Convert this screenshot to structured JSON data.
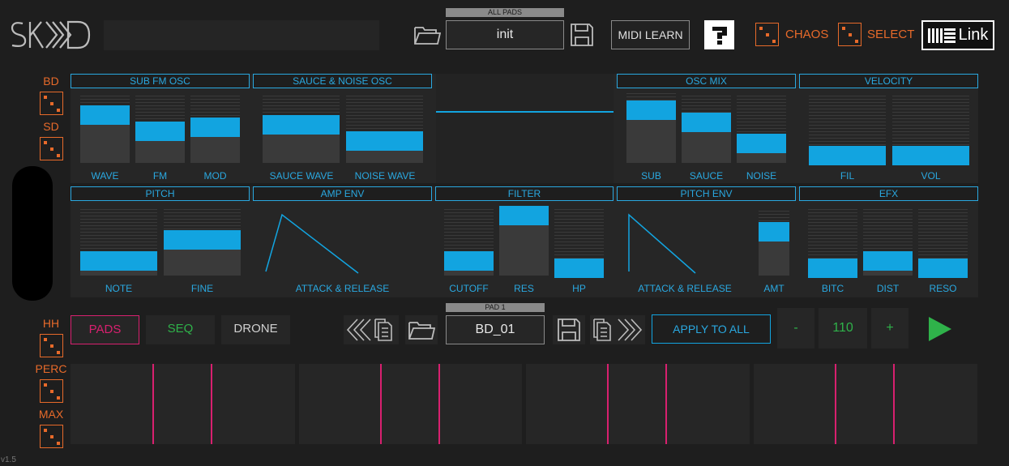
{
  "header": {
    "preset_caption": "ALL PADS",
    "preset_name": "init",
    "midi_learn_label": "MIDI LEARN",
    "chaos_label": "CHAOS",
    "select_label": "SELECT",
    "link_label": "Link"
  },
  "sidebar": {
    "pads": [
      {
        "label": "BD"
      },
      {
        "label": "SD"
      },
      {
        "label": "HH"
      },
      {
        "label": "PERC"
      },
      {
        "label": "MAX"
      }
    ]
  },
  "panels": {
    "sub_fm_osc": {
      "title": "SUB FM OSC",
      "sliders": [
        {
          "label": "WAVE",
          "value": 0.8
        },
        {
          "label": "FM",
          "value": 0.45
        },
        {
          "label": "MOD",
          "value": 0.55
        }
      ]
    },
    "sauce_noise_osc": {
      "title": "SAUCE & NOISE OSC",
      "sliders": [
        {
          "label": "SAUCE WAVE",
          "value": 0.6
        },
        {
          "label": "NOISE WAVE",
          "value": 0.25
        }
      ]
    },
    "osc_mix": {
      "title": "OSC MIX",
      "sliders": [
        {
          "label": "SUB",
          "value": 0.85
        },
        {
          "label": "SAUCE",
          "value": 0.65
        },
        {
          "label": "NOISE",
          "value": 0.2
        }
      ]
    },
    "velocity": {
      "title": "VELOCITY",
      "sliders": [
        {
          "label": "FIL",
          "value": 0.0
        },
        {
          "label": "VOL",
          "value": 0.0
        }
      ]
    },
    "pitch": {
      "title": "PITCH",
      "sliders": [
        {
          "label": "NOTE",
          "value": 0.1
        },
        {
          "label": "FINE",
          "value": 0.55
        }
      ]
    },
    "amp_env": {
      "title": "AMP ENV",
      "label": "ATTACK & RELEASE"
    },
    "filter": {
      "title": "FILTER",
      "sliders": [
        {
          "label": "CUTOFF",
          "value": 0.1
        },
        {
          "label": "RES",
          "value": 1.0
        },
        {
          "label": "HP",
          "value": 0.0
        }
      ]
    },
    "pitch_env": {
      "title": "PITCH ENV",
      "label": "ATTACK & RELEASE",
      "amt_label": "AMT",
      "amt_value": 0.75
    },
    "efx": {
      "title": "EFX",
      "sliders": [
        {
          "label": "BITC",
          "value": 0.0
        },
        {
          "label": "DIST",
          "value": 0.1
        },
        {
          "label": "RESO",
          "value": 0.0
        }
      ]
    }
  },
  "transport": {
    "tabs": [
      {
        "label": "PADS",
        "color": "#d8206f"
      },
      {
        "label": "SEQ",
        "color": "#2fb24a"
      },
      {
        "label": "DRONE",
        "color": "#d0d0d0"
      }
    ],
    "pad_caption": "PAD 1",
    "pad_preset": "BD_01",
    "apply_all_label": "APPLY TO ALL",
    "bpm_minus": "-",
    "bpm_value": "110",
    "bpm_plus": "+"
  },
  "version": "v1.5",
  "colors": {
    "accent": "#12a4e0",
    "orange": "#e76a2a",
    "pink": "#d8206f",
    "green": "#2fb24a"
  }
}
